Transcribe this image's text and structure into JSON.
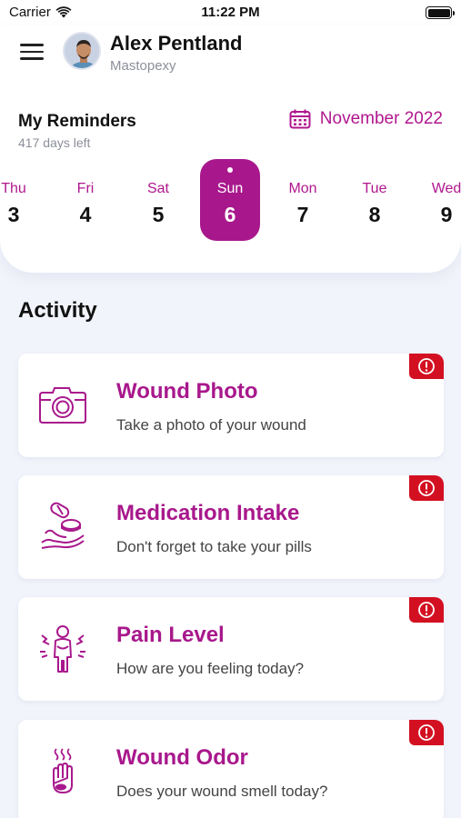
{
  "status_bar": {
    "carrier": "Carrier",
    "time": "11:22 PM"
  },
  "header": {
    "user_name": "Alex Pentland",
    "procedure": "Mastopexy"
  },
  "reminders": {
    "title": "My Reminders",
    "days_left": "417 days left",
    "month": "November 2022"
  },
  "days": [
    {
      "name": "Thu",
      "num": "3",
      "selected": false
    },
    {
      "name": "Fri",
      "num": "4",
      "selected": false
    },
    {
      "name": "Sat",
      "num": "5",
      "selected": false
    },
    {
      "name": "Sun",
      "num": "6",
      "selected": true
    },
    {
      "name": "Mon",
      "num": "7",
      "selected": false
    },
    {
      "name": "Tue",
      "num": "8",
      "selected": false
    },
    {
      "name": "Wed",
      "num": "9",
      "selected": false
    }
  ],
  "activity": {
    "title": "Activity",
    "items": [
      {
        "title": "Wound Photo",
        "subtitle": "Take a photo of your wound",
        "icon": "camera-icon"
      },
      {
        "title": "Medication Intake",
        "subtitle": "Don't forget to take your pills",
        "icon": "pills-hand-icon"
      },
      {
        "title": "Pain Level",
        "subtitle": "How are you feeling today?",
        "icon": "pain-person-icon"
      },
      {
        "title": "Wound Odor",
        "subtitle": "Does your wound smell today?",
        "icon": "odor-hand-icon"
      }
    ]
  },
  "colors": {
    "accent": "#a8188c",
    "alert": "#d31021",
    "background": "#f2f4fb"
  }
}
